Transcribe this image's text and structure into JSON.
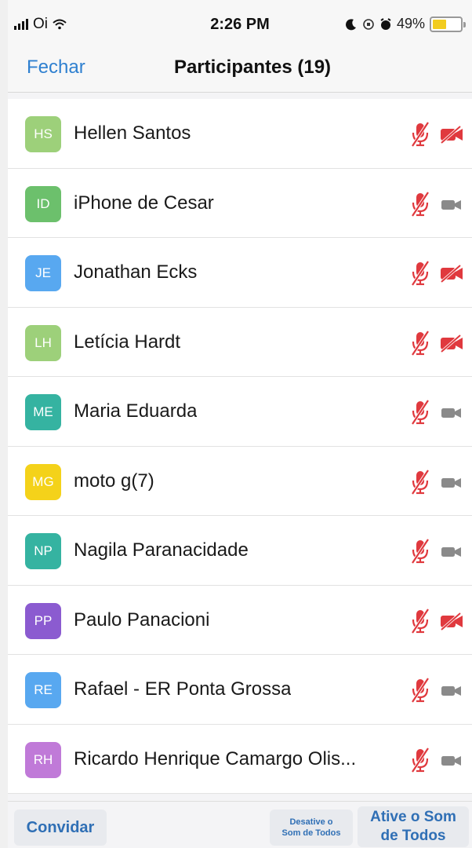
{
  "status_bar": {
    "carrier": "Oi",
    "time": "2:26 PM",
    "battery_percent": "49%",
    "battery_level": 0.49
  },
  "nav": {
    "close_label": "Fechar",
    "title": "Participantes (19)"
  },
  "participants": [
    {
      "initials": "HS",
      "name": "Hellen Santos",
      "avatar_color": "#9dd07a",
      "video_off_red": true
    },
    {
      "initials": "ID",
      "name": "iPhone de Cesar",
      "avatar_color": "#6cc06c",
      "video_off_red": false
    },
    {
      "initials": "JE",
      "name": "Jonathan Ecks",
      "avatar_color": "#58a8f0",
      "video_off_red": true
    },
    {
      "initials": "LH",
      "name": "Letícia Hardt",
      "avatar_color": "#9dd07a",
      "video_off_red": true
    },
    {
      "initials": "ME",
      "name": "Maria Eduarda",
      "avatar_color": "#35b3a1",
      "video_off_red": false
    },
    {
      "initials": "MG",
      "name": "moto g(7)",
      "avatar_color": "#f4d21a",
      "video_off_red": false
    },
    {
      "initials": "NP",
      "name": "Nagila Paranacidade",
      "avatar_color": "#35b3a1",
      "video_off_red": false
    },
    {
      "initials": "PP",
      "name": "Paulo Panacioni",
      "avatar_color": "#8b5bd0",
      "video_off_red": true
    },
    {
      "initials": "RE",
      "name": "Rafael - ER Ponta Grossa",
      "avatar_color": "#58a8f0",
      "video_off_red": false
    },
    {
      "initials": "RH",
      "name": "Ricardo Henrique Camargo Olis...",
      "avatar_color": "#c07ad8",
      "video_off_red": false
    }
  ],
  "bottom": {
    "invite_label": "Convidar",
    "mute_all_line1": "Desative o",
    "mute_all_line2": "Som de Todos",
    "unmute_all_line1": "Ative o Som",
    "unmute_all_line2": "de Todos"
  },
  "colors": {
    "accent": "#2f80d0",
    "muted_red": "#e0393e",
    "cam_gray": "#8a8a8a"
  }
}
